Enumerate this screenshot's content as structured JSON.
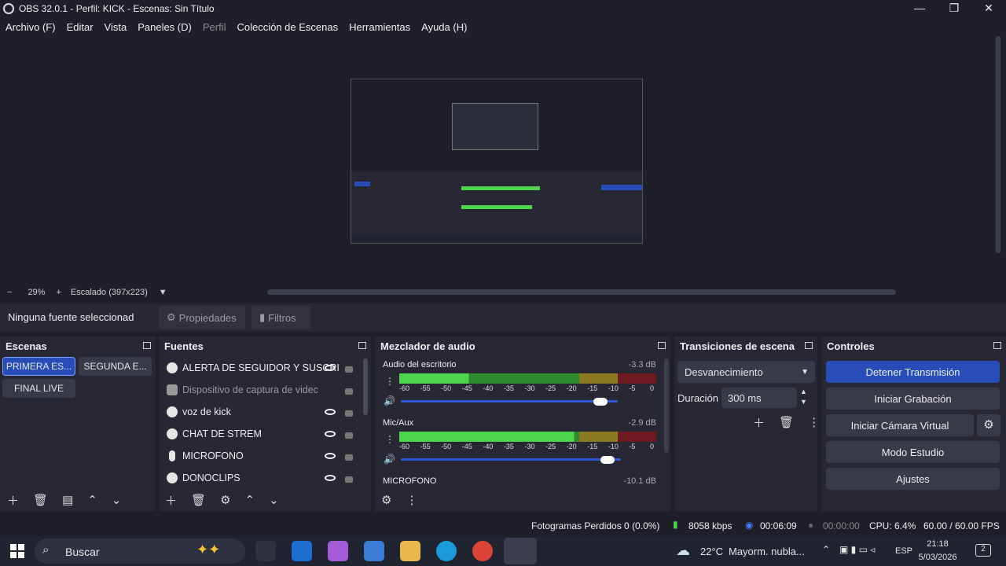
{
  "window": {
    "title": "OBS 32.0.1 - Perfil: KICK - Escenas: Sin Título"
  },
  "menu": [
    "Archivo (F)",
    "Editar",
    "Vista",
    "Paneles (D)",
    "Perfil",
    "Colección de Escenas",
    "Herramientas",
    "Ayuda (H)"
  ],
  "zoom": {
    "minus": "−",
    "level": "29%",
    "plus": "+",
    "scaling": "Escalado (397x223)"
  },
  "props": {
    "no_source": "Ninguna fuente seleccionad",
    "properties": "Propiedades",
    "filters": "Filtros"
  },
  "scenes": {
    "title": "Escenas",
    "items": [
      "PRIMERA ES...",
      "SEGUNDA E...",
      "FINAL LIVE"
    ]
  },
  "sources": {
    "title": "Fuentes",
    "items": [
      "ALERTA DE SEGUIDOR Y SUSCRI",
      "Dispositivo de captura de videc",
      "voz de kick",
      "CHAT DE STREM",
      "MICROFONO",
      "DONOCLIPS"
    ]
  },
  "mixer": {
    "title": "Mezclador de audio",
    "channels": [
      {
        "name": "Audio del escritorio",
        "db": "-3.3 dB",
        "level": 0.27,
        "fader": 0.92
      },
      {
        "name": "Mic/Aux",
        "db": "-2.9 dB",
        "level": 0.68,
        "fader": 0.94
      },
      {
        "name": "MICROFONO",
        "db": "-10.1 dB"
      }
    ],
    "scale": [
      "-60",
      "-55",
      "-50",
      "-45",
      "-40",
      "-35",
      "-30",
      "-25",
      "-20",
      "-15",
      "-10",
      "-5",
      "0"
    ]
  },
  "transitions": {
    "title": "Transiciones de escena",
    "selected": "Desvanecimiento",
    "duration_label": "Duración",
    "duration_value": "300 ms"
  },
  "controls": {
    "title": "Controles",
    "stop_stream": "Detener Transmisión",
    "start_rec": "Iniciar Grabación",
    "virtual_cam": "Iniciar Cámara Virtual",
    "studio": "Modo Estudio",
    "settings": "Ajustes"
  },
  "status": {
    "dropped": "Fotogramas Perdidos 0 (0.0%)",
    "kbps": "8058 kbps",
    "stream_time": "00:06:09",
    "rec_time": "00:00:00",
    "cpu": "CPU: 6.4%",
    "fps": "60.00 / 60.00 FPS"
  },
  "taskbar": {
    "search": "Buscar",
    "weather_temp": "22°C",
    "weather_text": "Mayorm. nubla...",
    "lang": "ESP",
    "time": "21:18",
    "date": "5/03/2026",
    "notif": "2"
  },
  "colors": {
    "bg": "#1e1f29",
    "panel": "#272833",
    "accent": "#284cb8",
    "green": "#4cd44c",
    "yellow": "#d4b43a",
    "red": "#b3202a"
  }
}
